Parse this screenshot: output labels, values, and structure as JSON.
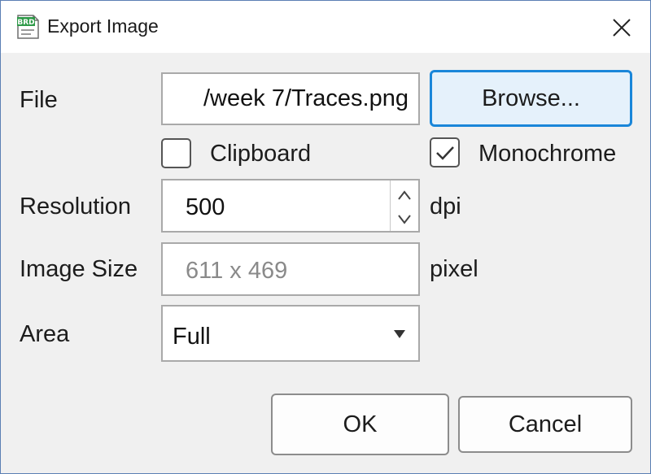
{
  "window": {
    "title": "Export Image",
    "app_icon_text": "BRD"
  },
  "form": {
    "file_label": "File",
    "file_value": "/week 7/Traces.png",
    "browse_label": "Browse...",
    "clipboard_label": "Clipboard",
    "clipboard_checked": false,
    "monochrome_label": "Monochrome",
    "monochrome_checked": true,
    "resolution_label": "Resolution",
    "resolution_value": "500",
    "resolution_unit": "dpi",
    "image_size_label": "Image Size",
    "image_size_value": "611 x 469",
    "image_size_unit": "pixel",
    "area_label": "Area",
    "area_value": "Full"
  },
  "buttons": {
    "ok_label": "OK",
    "cancel_label": "Cancel"
  },
  "colors": {
    "focus_accent": "#1a86d9",
    "window_border": "#5b7fb4",
    "app_icon_green": "#2e9a48"
  },
  "icons": {
    "app": "brd-document-icon",
    "close": "close-icon",
    "check": "checkmark-icon",
    "spin_up": "triangle-up-icon",
    "spin_down": "triangle-down-icon",
    "dropdown": "triangle-down-icon"
  }
}
